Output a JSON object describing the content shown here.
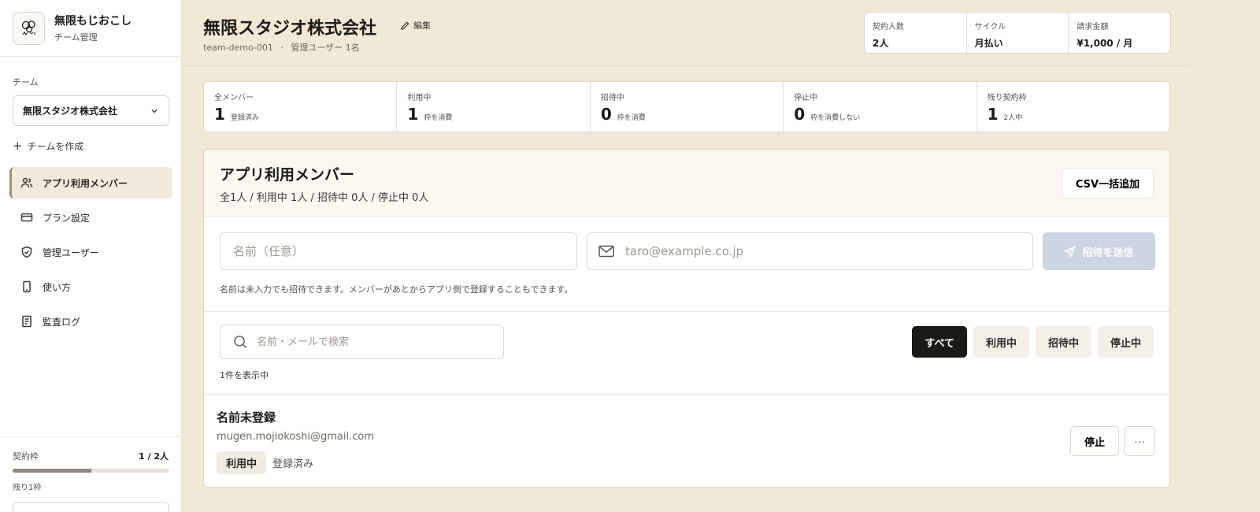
{
  "brand": {
    "name": "無限もじおこし",
    "subtitle": "チーム管理"
  },
  "sidebar": {
    "team_label": "チーム",
    "team_selected": "無限スタジオ株式会社",
    "create_team": "チームを作成",
    "items": [
      {
        "label": "アプリ利用メンバー",
        "icon": "users-icon",
        "active": true
      },
      {
        "label": "プラン設定",
        "icon": "credit-card-icon",
        "active": false
      },
      {
        "label": "管理ユーザー",
        "icon": "shield-check-icon",
        "active": false
      },
      {
        "label": "使い方",
        "icon": "phone-icon",
        "active": false
      },
      {
        "label": "監査ログ",
        "icon": "document-icon",
        "active": false
      }
    ],
    "quota": {
      "label": "契約枠",
      "value": "1 / 2人",
      "fraction": 0.5,
      "remaining": "残り1枠"
    }
  },
  "header": {
    "title": "無限スタジオ株式会社",
    "edit": "編集",
    "team_id": "team-demo-001",
    "separator": "·",
    "admins": "管理ユーザー 1名",
    "contract": [
      {
        "label": "契約人数",
        "value": "2人"
      },
      {
        "label": "サイクル",
        "value": "月払い"
      },
      {
        "label": "請求金額",
        "value": "¥1,000 / 月"
      }
    ]
  },
  "stats": [
    {
      "label": "全メンバー",
      "value": "1",
      "note": "登録済み"
    },
    {
      "label": "利用中",
      "value": "1",
      "note": "枠を消費"
    },
    {
      "label": "招待中",
      "value": "0",
      "note": "枠を消費"
    },
    {
      "label": "停止中",
      "value": "0",
      "note": "枠を消費しない"
    },
    {
      "label": "残り契約枠",
      "value": "1",
      "note": "2人中"
    }
  ],
  "members_card": {
    "title": "アプリ利用メンバー",
    "summary": "全1人 / 利用中 1人 / 招待中 0人 / 停止中 0人",
    "csv_button": "CSV一括追加"
  },
  "invite": {
    "name_placeholder": "名前（任意）",
    "email_placeholder": "taro@example.co.jp",
    "send_button": "招待を送信",
    "hint": "名前は未入力でも招待できます。メンバーがあとからアプリ側で登録することもできます。"
  },
  "filters": {
    "search_placeholder": "名前・メールで検索",
    "tabs": [
      {
        "label": "すべて",
        "active": true
      },
      {
        "label": "利用中",
        "active": false
      },
      {
        "label": "招待中",
        "active": false
      },
      {
        "label": "停止中",
        "active": false
      }
    ],
    "count": "1件を表示中"
  },
  "members": [
    {
      "name": "名前未登録",
      "email": "mugen.mojiokoshi@gmail.com",
      "status": "利用中",
      "registration": "登録済み",
      "stop_button": "停止",
      "more": "···"
    }
  ],
  "colors": {
    "background": "#f1e8d6",
    "primary_dark": "#1c1a17",
    "disabled_button": "#ccd5e0"
  }
}
